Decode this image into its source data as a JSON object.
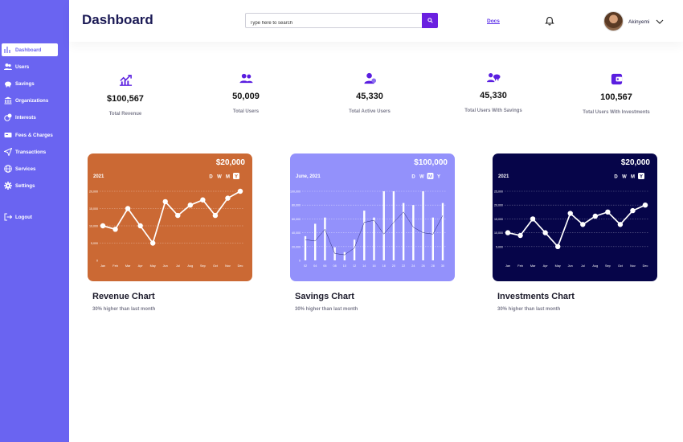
{
  "header": {
    "title": "Dashboard",
    "search_placeholder": "Type here to search",
    "docs_label": "Docs",
    "username": "Akinyemi"
  },
  "sidebar": {
    "items": [
      {
        "label": "Dashboard",
        "icon": "chart-icon",
        "active": true
      },
      {
        "label": "Users",
        "icon": "users-icon"
      },
      {
        "label": "Savings",
        "icon": "piggy-bank-icon"
      },
      {
        "label": "Organizations",
        "icon": "bank-icon"
      },
      {
        "label": "Interests",
        "icon": "coins-icon"
      },
      {
        "label": "Fees & Charges",
        "icon": "receipt-icon"
      },
      {
        "label": "Transactions",
        "icon": "send-icon"
      },
      {
        "label": "Services",
        "icon": "globe-icon"
      },
      {
        "label": "Settings",
        "icon": "gear-icon"
      },
      {
        "label": "Logout",
        "icon": "logout-icon"
      }
    ]
  },
  "stats": [
    {
      "value": "$100,567",
      "label": "Total Revenue",
      "icon": "trending-up-icon"
    },
    {
      "value": "50,009",
      "label": "Total Users",
      "icon": "users-icon"
    },
    {
      "value": "45,330",
      "label": "Total Active Users",
      "icon": "active-user-icon"
    },
    {
      "value": "45,330",
      "label": "Total Users With Savings",
      "icon": "user-savings-icon"
    },
    {
      "value": "100,567",
      "label": "Total Users With Investments",
      "icon": "wallet-icon"
    }
  ],
  "cards": [
    {
      "title": "Revenue Chart",
      "subtitle": "30% higher than last month"
    },
    {
      "title": "Savings Chart",
      "subtitle": "30% higher than last month"
    },
    {
      "title": "Investments Chart",
      "subtitle": "30% higher than last month"
    }
  ],
  "chart_data": [
    {
      "type": "line",
      "name": "revenue",
      "amount": "$20,000",
      "period": "2021",
      "toggles": [
        "D",
        "W",
        "M",
        "Y"
      ],
      "active_toggle": "Y",
      "colors": {
        "bg": "#cb6934",
        "line": "#ffffff",
        "grid": "rgba(255,255,255,0.5)",
        "active": "#ffffff"
      },
      "categories": [
        "Jan",
        "Feb",
        "Mar",
        "Apr",
        "May",
        "Jun",
        "Jul",
        "Aug",
        "Sep",
        "Oct",
        "Nov",
        "Dec"
      ],
      "values": [
        10000,
        9000,
        15000,
        10000,
        5000,
        17000,
        13000,
        16000,
        17500,
        13000,
        18000,
        20000
      ],
      "ylim": [
        0,
        20000
      ],
      "ytick_values": [
        0,
        5000,
        10000,
        15000,
        20000
      ],
      "ytick_labels": [
        "0",
        "5,000",
        "10,000",
        "15,000",
        "20,000"
      ]
    },
    {
      "type": "bar",
      "name": "savings",
      "amount": "$100,000",
      "period": "June, 2021",
      "toggles": [
        "D",
        "W",
        "M",
        "Y"
      ],
      "active_toggle": "M",
      "colors": {
        "bg": "#9391fb",
        "bar": "#ffffff",
        "line": "#2a2c7a",
        "grid": "rgba(255,255,255,0.55)",
        "active": "#ffffff"
      },
      "categories": [
        "02",
        "04",
        "06",
        "08",
        "10",
        "12",
        "14",
        "16",
        "18",
        "20",
        "22",
        "24",
        "26",
        "28",
        "30"
      ],
      "values": [
        35000,
        53000,
        62000,
        19000,
        12000,
        30000,
        72000,
        62000,
        100000,
        100000,
        83000,
        80000,
        100000,
        62000,
        83000
      ],
      "trend": [
        30000,
        28000,
        45000,
        10000,
        8000,
        18000,
        55000,
        58000,
        38000,
        55000,
        70000,
        48000,
        40000,
        38000,
        65000
      ],
      "ylim": [
        0,
        100000
      ],
      "ytick_values": [
        0,
        20000,
        40000,
        60000,
        80000,
        100000
      ],
      "ytick_labels": [
        "0",
        "20,000",
        "40,000",
        "60,000",
        "80,000",
        "100,000"
      ]
    },
    {
      "type": "line",
      "name": "investments",
      "amount": "$20,000",
      "period": "2021",
      "toggles": [
        "D",
        "W",
        "M",
        "Y"
      ],
      "active_toggle": "Y",
      "colors": {
        "bg": "#060549",
        "line": "#ffffff",
        "grid": "rgba(255,255,255,0.4)",
        "active": "#ffffff"
      },
      "categories": [
        "Jan",
        "Feb",
        "Mar",
        "Apr",
        "May",
        "Jun",
        "Jul",
        "Aug",
        "Sep",
        "Oct",
        "Nov",
        "Dec"
      ],
      "values": [
        10000,
        9000,
        15000,
        10000,
        5000,
        17000,
        13000,
        16000,
        17500,
        13000,
        18000,
        20000
      ],
      "ylim": [
        0,
        25000
      ],
      "ytick_values": [
        0,
        5000,
        10000,
        15000,
        20000,
        25000
      ],
      "ytick_labels": [
        "",
        "5,000",
        "10,000",
        "15,000",
        "20,000",
        "25,000"
      ]
    }
  ]
}
